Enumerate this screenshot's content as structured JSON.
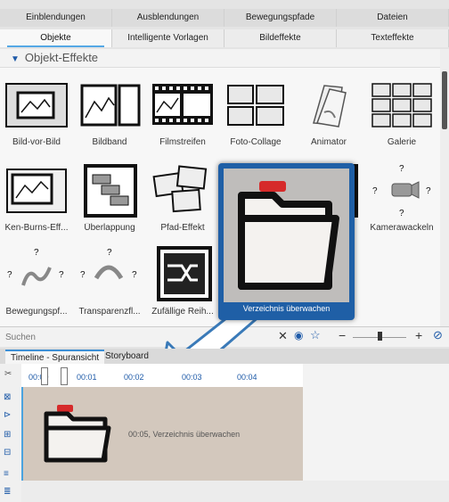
{
  "top_tabs": [
    "Einblendungen",
    "Ausblendungen",
    "Bewegungspfade",
    "Dateien"
  ],
  "sub_tabs": [
    "Objekte",
    "Intelligente Vorlagen",
    "Bildeffekte",
    "Texteffekte"
  ],
  "active_sub_tab": "Objekte",
  "section_title": "Objekt-Effekte",
  "items": [
    {
      "label": "Bild-vor-Bild",
      "icon": "picture-in-picture-icon"
    },
    {
      "label": "Bildband",
      "icon": "picture-band-icon"
    },
    {
      "label": "Filmstreifen",
      "icon": "film-strip-icon"
    },
    {
      "label": "Foto-Collage",
      "icon": "photo-collage-icon"
    },
    {
      "label": "Animator",
      "icon": "animator-icon"
    },
    {
      "label": "Galerie",
      "icon": "gallery-icon"
    },
    {
      "label": "Ken-Burns-Eff...",
      "icon": "ken-burns-icon"
    },
    {
      "label": "Überlappung",
      "icon": "overlap-icon"
    },
    {
      "label": "Pfad-Effekt",
      "icon": "path-effect-icon"
    },
    {
      "label": "",
      "icon": "cube-icon"
    },
    {
      "label": "",
      "icon": "arrow-frame-icon"
    },
    {
      "label": "Kamerawackeln",
      "icon": "camera-shake-icon"
    },
    {
      "label": "Bewegungspf...",
      "icon": "motion-path-icon"
    },
    {
      "label": "Transparenzfl...",
      "icon": "transparency-flow-icon"
    },
    {
      "label": "Zufällige Reih...",
      "icon": "shuffle-icon"
    }
  ],
  "popup_caption": "Verzeichnis überwachen",
  "search_placeholder": "Suchen",
  "timeline_tabs": [
    "Timeline - Spuransicht",
    "Storyboard"
  ],
  "ruler_labels": [
    "00:00",
    "00:01",
    "00:02",
    "00:03",
    "00:04"
  ],
  "clip_label": "00:05, Verzeichnis überwachen"
}
